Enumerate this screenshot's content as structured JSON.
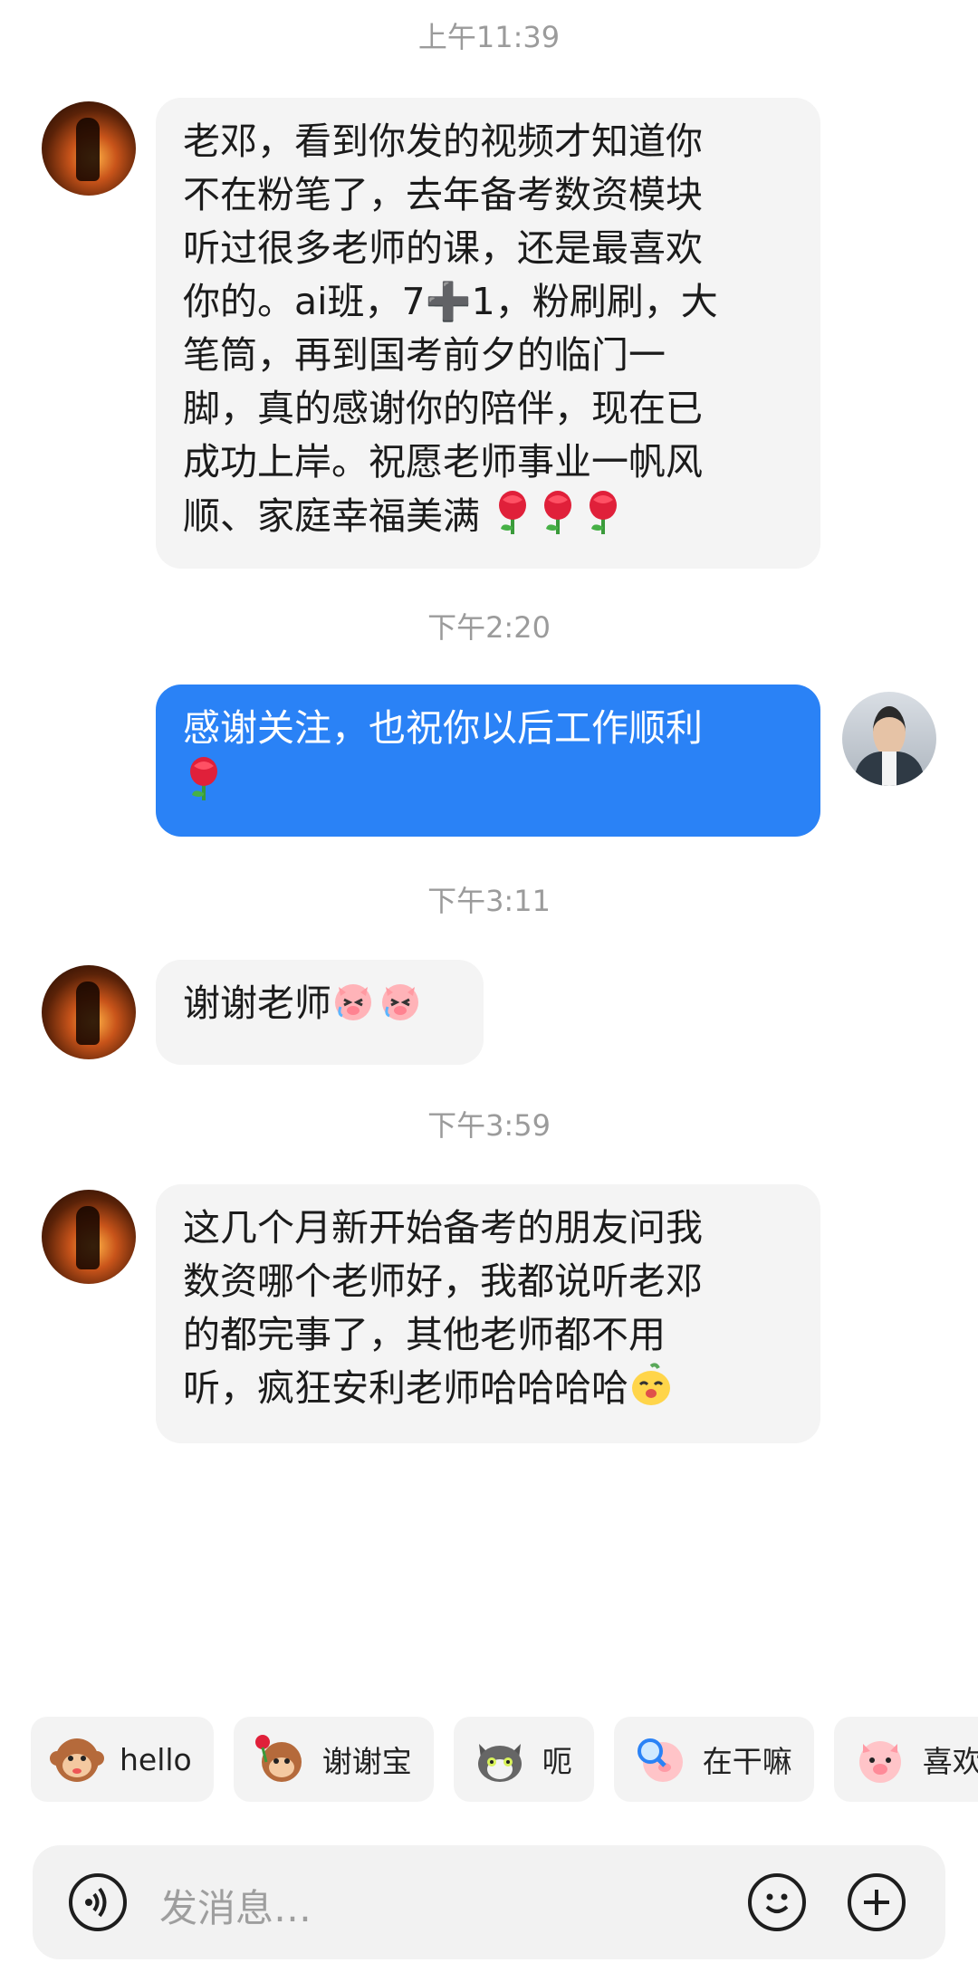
{
  "messages": [
    {
      "time": "上午11:39",
      "sender": "other",
      "lines": [
        "老邓，看到你发的视频才知道你",
        "不在粉笔了，去年备考数资模块",
        "听过很多老师的课，还是最喜欢",
        "你的。ai班，7➕1，粉刷刷，大",
        "笔筒，再到国考前夕的临门一",
        "脚，真的感谢你的陪伴，现在已",
        "成功上岸。祝愿老师事业一帆风",
        "顺、家庭幸福美满"
      ],
      "trailing_emojis": [
        "rose",
        "rose",
        "rose"
      ]
    },
    {
      "time": "下午2:20",
      "sender": "me",
      "lines": [
        "感谢关注，也祝你以后工作顺利"
      ],
      "trailing_emojis": [
        "rose"
      ]
    },
    {
      "time": "下午3:11",
      "sender": "other",
      "lines": [
        "谢谢老师"
      ],
      "trailing_emojis": [
        "crying-pig-face",
        "crying-pig-face"
      ]
    },
    {
      "time": "下午3:59",
      "sender": "other",
      "lines": [
        "这几个月新开始备考的朋友问我",
        "数资哪个老师好，我都说听老邓",
        "的都完事了，其他老师都不用",
        "听，疯狂安利老师哈哈哈哈"
      ],
      "trailing_emojis": [
        "smiling-yellow-face"
      ]
    }
  ],
  "quick_replies": [
    {
      "label": "hello",
      "sticker": "monkey-sticker"
    },
    {
      "label": "谢谢宝",
      "sticker": "monkey-rose-sticker"
    },
    {
      "label": "呃",
      "sticker": "cat-sticker"
    },
    {
      "label": "在干嘛",
      "sticker": "pig-magnifier-sticker"
    },
    {
      "label": "喜欢",
      "sticker": "pig-heart-sticker"
    }
  ],
  "composer": {
    "placeholder": "发消息…",
    "voice_icon": "voice-icon",
    "emoji_icon": "smiley-icon",
    "plus_icon": "plus-icon"
  },
  "colors": {
    "outgoing_bubble": "#2a82f6",
    "incoming_bubble": "#f4f4f4",
    "timestamp": "#9b9b9b"
  }
}
